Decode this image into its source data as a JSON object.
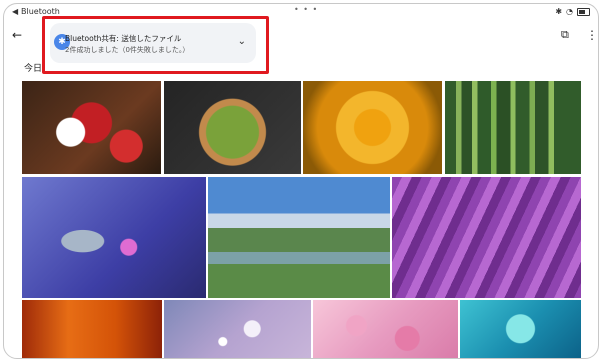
{
  "status_bar": {
    "back_glyph": "◀",
    "app": "Bluetooth",
    "dots": "• • •",
    "bluetooth_icon": "✱",
    "battery_text": "🔋"
  },
  "toolbar": {
    "back_icon": "←",
    "cast_icon": "⧉",
    "more_icon": "⋮",
    "date_header": "今日"
  },
  "notification": {
    "icon": "✱",
    "title": "Bluetooth共有: 送信したファイル",
    "body": "2件成功しました（0件失敗しました。）",
    "chevron": "⌄"
  },
  "photos": [
    {
      "name": "strawberries"
    },
    {
      "name": "spinach"
    },
    {
      "name": "yellow-rose"
    },
    {
      "name": "grass"
    },
    {
      "name": "water-lily"
    },
    {
      "name": "mountain-valley"
    },
    {
      "name": "lavender-field"
    },
    {
      "name": "autumn-forest"
    },
    {
      "name": "sparkles"
    },
    {
      "name": "cherry-blossoms"
    },
    {
      "name": "underwater"
    }
  ]
}
